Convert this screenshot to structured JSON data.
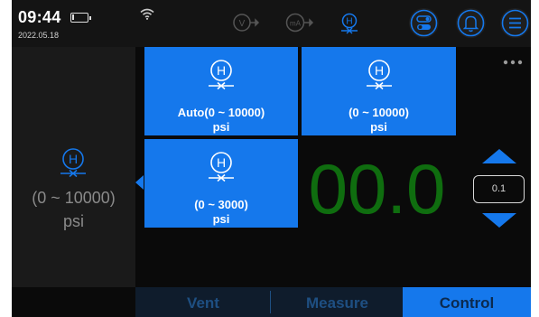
{
  "status_bar": {
    "time": "09:44",
    "date": "2022.05.18",
    "battery_level": 0.15,
    "icons": [
      "wifi-icon",
      "voltage-icon",
      "milliamp-icon",
      "hydraulic-pressure-icon"
    ],
    "voltage_label": "V",
    "milliamp_label": "mA",
    "hydraulic_label": "H",
    "buttons": [
      "toggle-icon",
      "bell-icon",
      "menu-icon"
    ]
  },
  "left_panel": {
    "icon_label": "H",
    "range": "(0 ~ 10000)",
    "unit": "psi"
  },
  "range_options": [
    {
      "icon_label": "H",
      "range": "Auto(0 ~ 10000)",
      "unit": "psi"
    },
    {
      "icon_label": "H",
      "range": "(0 ~ 10000)",
      "unit": "psi"
    },
    {
      "icon_label": "H",
      "range": "(0 ~ 3000)",
      "unit": "psi"
    }
  ],
  "reading": {
    "value": "00.0"
  },
  "step": {
    "value": "0.1"
  },
  "tabs": [
    {
      "label": "Vent"
    },
    {
      "label": "Measure"
    },
    {
      "label": "Control"
    }
  ],
  "active_tab": "Control",
  "colors": {
    "accent": "#1578ec",
    "reading": "#0f6d0f",
    "background": "#0a0a0a",
    "inactive_tab_text": "#1e4f82"
  }
}
